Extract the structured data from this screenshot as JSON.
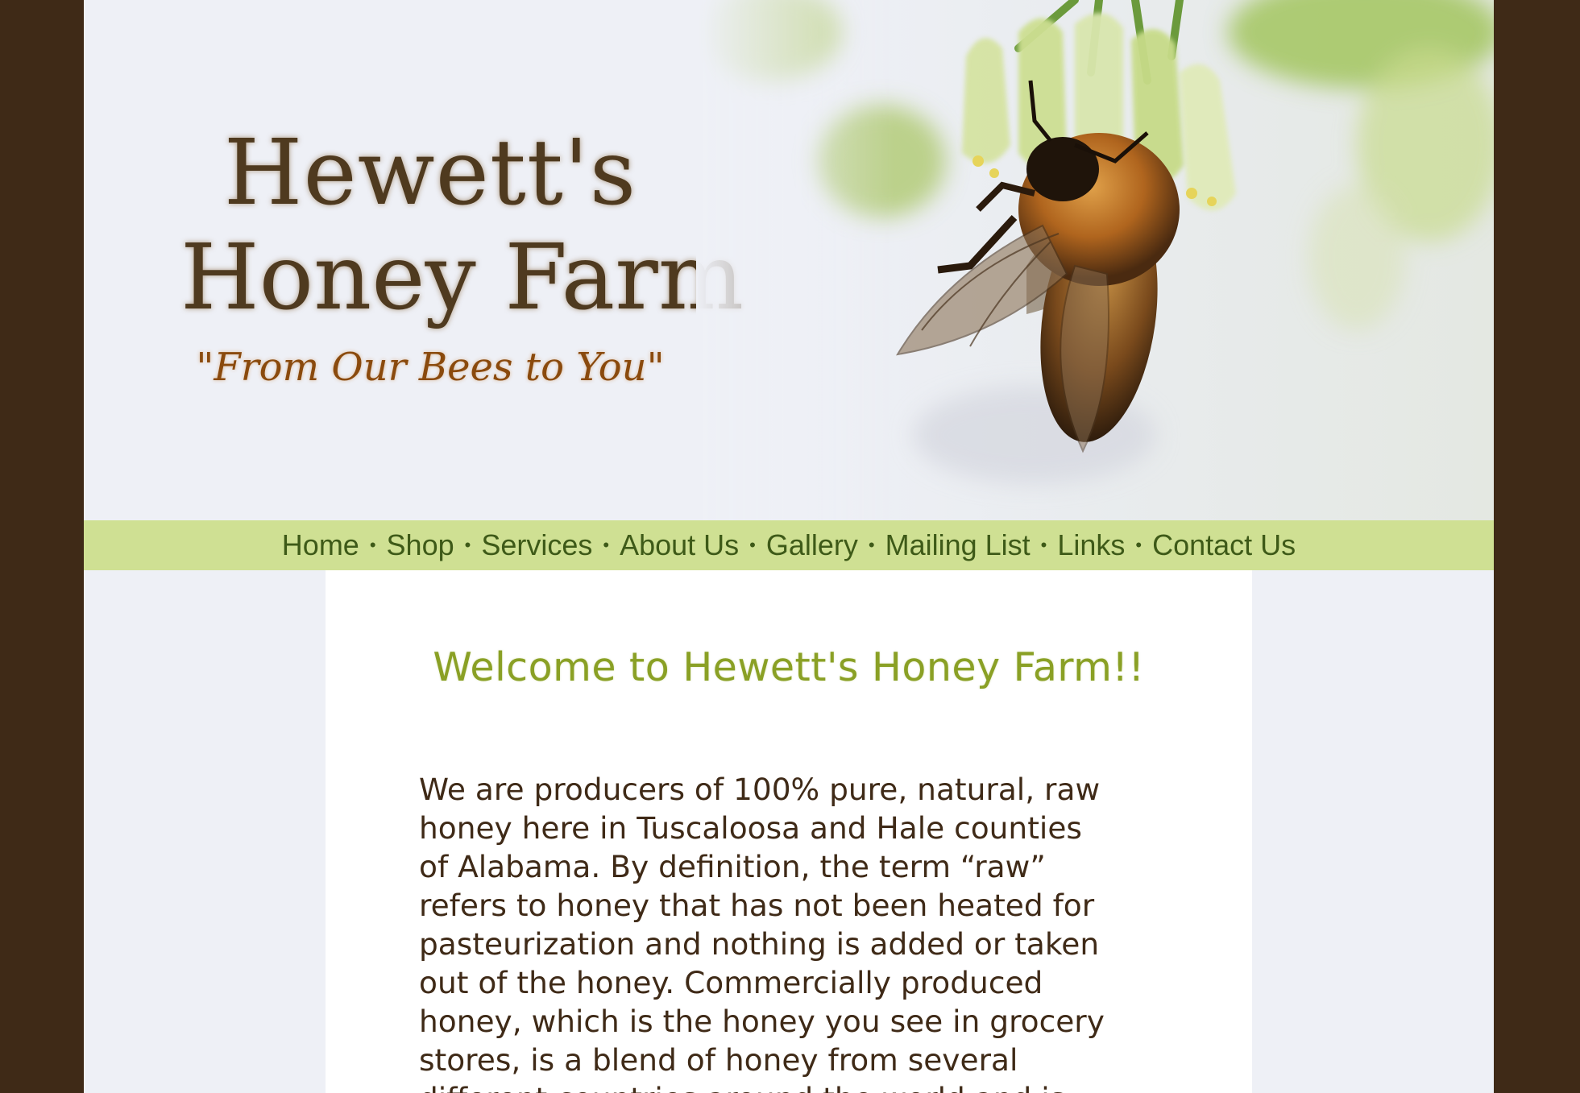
{
  "logo": {
    "line1": "Hewett's",
    "line2": "Honey Farm",
    "tagline": "\"From Our Bees to You\""
  },
  "banner_image": {
    "icon": "bee-on-flower-photo"
  },
  "nav": {
    "items": [
      "Home",
      "Shop",
      "Services",
      "About Us",
      "Gallery",
      "Mailing List",
      "Links",
      "Contact Us"
    ],
    "separator": "•"
  },
  "main": {
    "heading": "Welcome to Hewett's Honey Farm!!",
    "paragraph_lines": [
      "We are producers of 100% pure, natural, raw",
      "honey here in Tuscaloosa and Hale counties",
      "of Alabama. By definition, the term “raw”",
      "refers to honey that has not been heated for",
      "pasteurization and nothing is added or taken",
      "out of the honey. Commercially produced",
      "honey, which is the honey you see in grocery",
      "stores, is a blend of honey from several",
      "different countries around the world and is"
    ]
  },
  "colors": {
    "outer_background": "#3f2a17",
    "page_background": "#eef0f6",
    "nav_background": "#cfe093",
    "nav_text": "#3e5a18",
    "heading": "#8aa025",
    "body_text": "#3f2a17"
  }
}
